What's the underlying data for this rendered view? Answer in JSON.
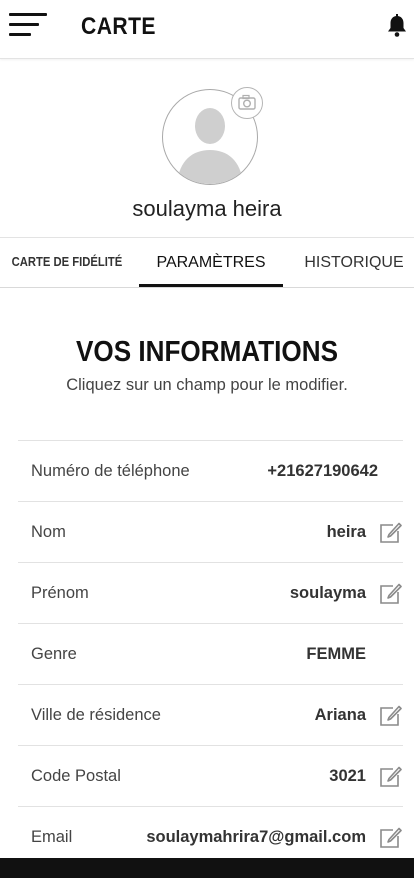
{
  "header": {
    "title": "CARTE"
  },
  "profile": {
    "name": "soulayma heira"
  },
  "tabs": [
    {
      "label": "CARTE DE FIDÉLITÉ"
    },
    {
      "label": "PARAMÈTRES"
    },
    {
      "label": "HISTORIQUE"
    }
  ],
  "info": {
    "title": "VOS INFORMATIONS",
    "subtitle": "Cliquez sur un champ pour le modifier.",
    "rows": [
      {
        "label": "Numéro de téléphone",
        "value": "+21627190642"
      },
      {
        "label": "Nom",
        "value": "heira"
      },
      {
        "label": "Prénom",
        "value": "soulayma"
      },
      {
        "label": "Genre",
        "value": "FEMME"
      },
      {
        "label": "Ville de résidence",
        "value": "Ariana"
      },
      {
        "label": "Code Postal",
        "value": "3021"
      },
      {
        "label": "Email",
        "value": "soulaymahrira7@gmail.com"
      }
    ]
  },
  "colors": {
    "accent": "#111111",
    "divider": "#e2e2e2",
    "background": "#ffffff"
  },
  "icons": [
    "menu-icon",
    "bell-icon",
    "avatar-icon",
    "camera-icon",
    "edit-icon"
  ]
}
